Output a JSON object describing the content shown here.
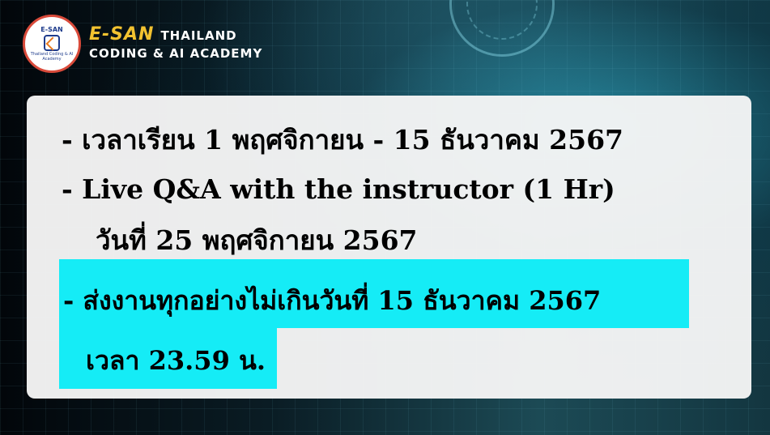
{
  "brand": {
    "badge_top": "E-SAN",
    "badge_sub": "Thailand Coding & AI Academy",
    "esan": "E-SAN",
    "thailand": "THAILAND",
    "tagline": "CODING & AI ACADEMY"
  },
  "schedule": {
    "line1": "-  เวลาเรียน 1 พฤศจิกายน - 15 ธันวาคม 2567",
    "line2": "-   Live Q&A with the instructor (1 Hr)",
    "line3": "วันที่ 25 พฤศจิกายน 2567",
    "line4": "-  ส่งงานทุกอย่างไม่เกินวันที่ 15 ธันวาคม 2567",
    "line5": "เวลา 23.59 น."
  },
  "colors": {
    "highlight": "#15ecf6",
    "card": "#f6f6f6",
    "brand_accent": "#f2c230"
  }
}
